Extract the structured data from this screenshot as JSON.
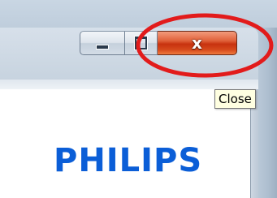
{
  "window": {
    "caption_buttons": {
      "minimize_icon": "minimize-icon",
      "maximize_icon": "maximize-icon",
      "close_label": "x",
      "close_icon": "close-icon"
    },
    "tooltip": {
      "text": "Close"
    },
    "highlight_color": "#e21b1b"
  },
  "content": {
    "brand_text": "PHILIPS",
    "brand_color": "#0b5ed7"
  },
  "colors": {
    "close_button_red": "#d64a1c",
    "tooltip_bg": "#ffffe1"
  }
}
